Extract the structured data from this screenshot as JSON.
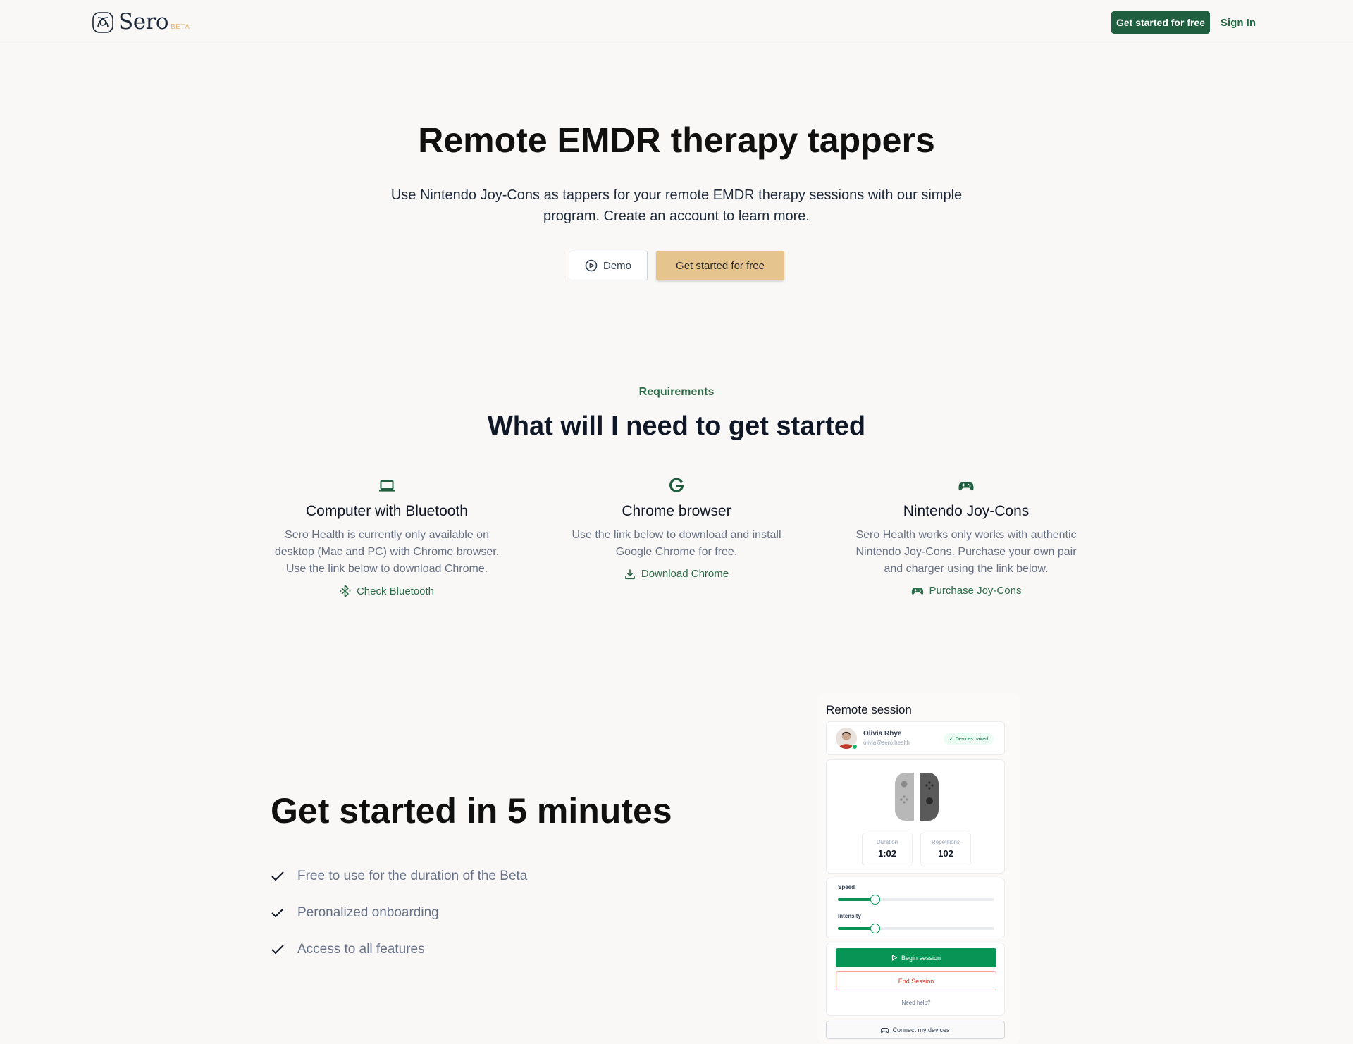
{
  "header": {
    "logo_text": "Sero",
    "logo_badge": "BETA",
    "cta_label": "Get started for free",
    "signin_label": "Sign In"
  },
  "hero": {
    "title": "Remote EMDR therapy tappers",
    "subtitle": "Use Nintendo Joy-Cons as tappers for your remote EMDR therapy sessions with our simple program. Create an account to learn more.",
    "demo_label": "Demo",
    "cta_label": "Get started for free"
  },
  "requirements": {
    "eyebrow": "Requirements",
    "title": "What will I need to get started",
    "items": [
      {
        "icon": "laptop-icon",
        "title": "Computer with Bluetooth",
        "description": "Sero Health is currently only available on desktop (Mac and PC) with Chrome browser. Use the link below to download Chrome.",
        "link_icon": "bluetooth-icon",
        "link_label": "Check Bluetooth"
      },
      {
        "icon": "google-icon",
        "title": "Chrome browser",
        "description": "Use the link below to download and install Google Chrome for free.",
        "link_icon": "download-icon",
        "link_label": "Download Chrome"
      },
      {
        "icon": "gamepad-icon",
        "title": "Nintendo Joy-Cons",
        "description": "Sero Health works only works with authentic Nintendo Joy-Cons. Purchase your own pair and charger using the link below.",
        "link_icon": "gamepad-icon",
        "link_label": "Purchase Joy-Cons"
      }
    ]
  },
  "get_started": {
    "title": "Get started in 5 minutes",
    "features": [
      "Free to use for the duration of the Beta",
      "Peronalized onboarding",
      "Access to all features"
    ]
  },
  "session_mock": {
    "title": "Remote session",
    "user_name": "Olivia Rhye",
    "user_email": "olivia@sero.health",
    "status_badge": "Devices paired",
    "duration_label": "Duration",
    "duration_value": "1:02",
    "repetitions_label": "Repetitions",
    "repetitions_value": "102",
    "speed_label": "Speed",
    "speed_level": 0.24,
    "intensity_label": "Intensity",
    "intensity_level": 0.24,
    "begin_label": "Begin session",
    "end_label": "End Session",
    "help_label": "Need help?",
    "connect_label": "Connect my devices"
  },
  "colors": {
    "brand_green": "#1f5f3f",
    "accent_gold": "#e6c48e",
    "link_green": "#2c6b47",
    "session_green": "#079455",
    "danger_red": "#d92d20"
  }
}
